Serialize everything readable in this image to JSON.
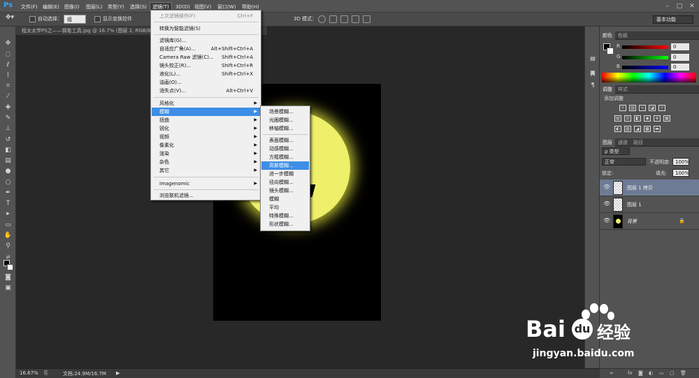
{
  "app": {
    "logo": "Ps"
  },
  "menubar": {
    "items": [
      "文件(F)",
      "编辑(E)",
      "图像(I)",
      "图层(L)",
      "类型(Y)",
      "选择(S)",
      "滤镜(T)",
      "3D(D)",
      "视图(V)",
      "窗口(W)",
      "帮助(H)"
    ],
    "active": "滤镜(T)"
  },
  "options": {
    "auto_select_label": "自动选择：",
    "auto_select_value": "组",
    "show_transform_label": "显示变换控件",
    "mode_3d_label": "3D 模式：",
    "workspace": "基本功能"
  },
  "document": {
    "tab_title": "程太太学PS之——钢笔工具.jpg @ 16.7% (图层 2, RGB/8) *"
  },
  "status": {
    "zoom": "16.67%",
    "doc_info": "文档:24.9M/16.7M"
  },
  "filter_menu": {
    "items": [
      {
        "label": "上次滤镜操作(F)",
        "shortcut": "Ctrl+F",
        "disabled": true
      },
      {
        "label": "转换为智能滤镜(S)",
        "shortcut": ""
      },
      {
        "label": "滤镜库(G)...",
        "shortcut": ""
      },
      {
        "label": "自适应广角(A)...",
        "shortcut": "Alt+Shift+Ctrl+A"
      },
      {
        "label": "Camera Raw 滤镜(C)...",
        "shortcut": "Shift+Ctrl+A"
      },
      {
        "label": "镜头校正(R)...",
        "shortcut": "Shift+Ctrl+R"
      },
      {
        "label": "液化(L)...",
        "shortcut": "Shift+Ctrl+X"
      },
      {
        "label": "油画(O)...",
        "shortcut": ""
      },
      {
        "label": "消失点(V)...",
        "shortcut": "Alt+Ctrl+V"
      },
      {
        "label": "风格化",
        "shortcut": "",
        "submenu": true
      },
      {
        "label": "模糊",
        "shortcut": "",
        "submenu": true,
        "highlighted": true
      },
      {
        "label": "扭曲",
        "shortcut": "",
        "submenu": true
      },
      {
        "label": "锐化",
        "shortcut": "",
        "submenu": true
      },
      {
        "label": "视频",
        "shortcut": "",
        "submenu": true
      },
      {
        "label": "像素化",
        "shortcut": "",
        "submenu": true
      },
      {
        "label": "渲染",
        "shortcut": "",
        "submenu": true
      },
      {
        "label": "杂色",
        "shortcut": "",
        "submenu": true
      },
      {
        "label": "其它",
        "shortcut": "",
        "submenu": true
      },
      {
        "label": "Imagenomic",
        "shortcut": "",
        "submenu": true
      },
      {
        "label": "浏览联机滤镜...",
        "shortcut": ""
      }
    ]
  },
  "blur_submenu": {
    "items": [
      {
        "label": "场景模糊..."
      },
      {
        "label": "光圈模糊..."
      },
      {
        "label": "移轴模糊..."
      },
      {
        "label": "表面模糊..."
      },
      {
        "label": "动感模糊..."
      },
      {
        "label": "方框模糊..."
      },
      {
        "label": "高斯模糊...",
        "highlighted": true
      },
      {
        "label": "进一步模糊"
      },
      {
        "label": "径向模糊..."
      },
      {
        "label": "镜头模糊..."
      },
      {
        "label": "模糊"
      },
      {
        "label": "平均"
      },
      {
        "label": "特殊模糊..."
      },
      {
        "label": "形状模糊..."
      }
    ]
  },
  "color_panel": {
    "tabs": [
      "颜色",
      "色板"
    ],
    "r_label": "R",
    "g_label": "G",
    "b_label": "B",
    "r": "0",
    "g": "0",
    "b": "0"
  },
  "adjust_panel": {
    "tabs": [
      "调整",
      "样式"
    ],
    "title": "添加调整"
  },
  "layers_panel": {
    "tabs": [
      "图层",
      "通道",
      "路径"
    ],
    "kind_filter": "ρ 类型",
    "blend_mode": "正常",
    "opacity_label": "不透明度:",
    "opacity": "100%",
    "lock_label": "锁定:",
    "fill_label": "填充:",
    "fill": "100%",
    "layers": [
      {
        "name": "图层 1 拷贝",
        "selected": true
      },
      {
        "name": "图层 1",
        "selected": false
      },
      {
        "name": "背景",
        "selected": false,
        "locked": true
      }
    ]
  },
  "watermark": {
    "brand": "Bai",
    "brand2": "经验",
    "url": "jingyan.baidu.com"
  },
  "colors": {
    "accent": "#3d8ee6",
    "glow": "#eef06a",
    "selected_layer": "#6d7c94"
  }
}
